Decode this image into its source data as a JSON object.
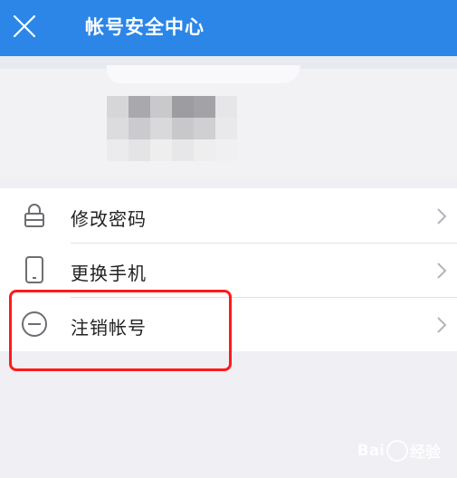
{
  "header": {
    "title": "帐号安全中心",
    "close_icon": "close-icon",
    "background_color": "#2b86e8"
  },
  "account": {
    "mosaic_colors": [
      "#d6d6d8",
      "#a9a9ad",
      "#c9c9cc",
      "#9d9da1",
      "#a3a3a7",
      "#e6e6e8",
      "#dcdcde",
      "#cbcbcf",
      "#d9d9dc",
      "#c8c8cb",
      "#d0d0d3",
      "#e9e9eb",
      "#ebebed",
      "#e4e4e6",
      "#eeeeef",
      "#e7e7e9",
      "#eeeeef",
      "#f0f0f2"
    ]
  },
  "menu": {
    "items": [
      {
        "label": "修改密码",
        "icon": "lock-icon"
      },
      {
        "label": "更换手机",
        "icon": "phone-icon"
      },
      {
        "label": "注销帐号",
        "icon": "minus-circle-icon"
      }
    ]
  },
  "annotation": {
    "color": "#ff1a1a",
    "highlighted_item": "注销帐号"
  },
  "watermark": {
    "text_prefix": "Bai",
    "text_suffix": "经验"
  }
}
